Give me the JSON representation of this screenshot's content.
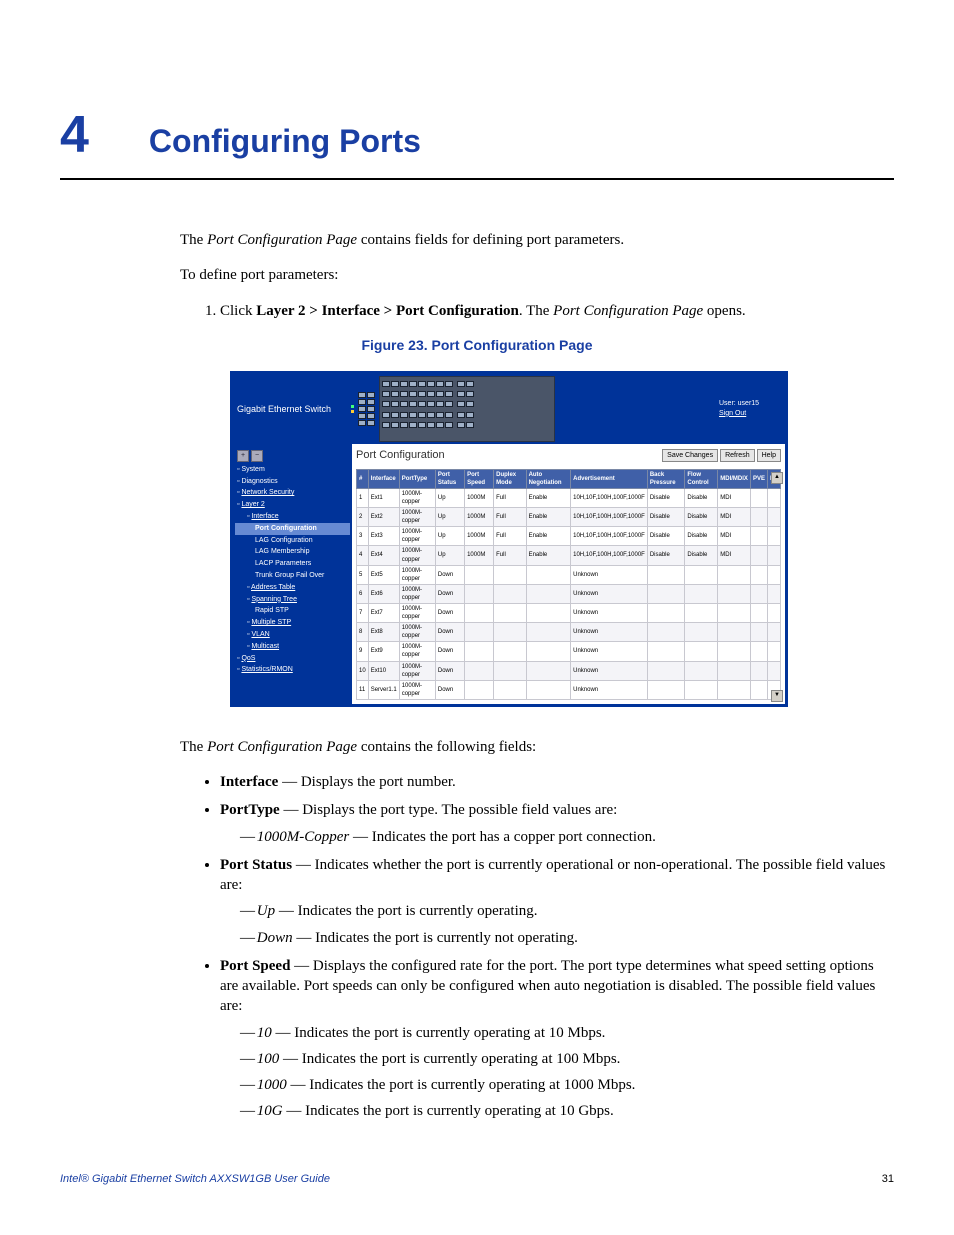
{
  "chapter": {
    "number": "4",
    "title": "Configuring Ports"
  },
  "intro_p1_a": "The ",
  "intro_p1_italic": "Port Configuration Page",
  "intro_p1_b": " contains fields for defining port parameters.",
  "intro_p2": "To define port parameters:",
  "step1_a": "Click ",
  "step1_bold": "Layer 2 > Interface > Port Configuration",
  "step1_b": ". The ",
  "step1_italic": "Port Configuration Page",
  "step1_c": " opens.",
  "figure_caption": "Figure 23. Port Configuration Page",
  "screenshot": {
    "device_name": "Gigabit Ethernet Switch",
    "user_label": "User: user15",
    "sign_out": "Sign Out",
    "page_title": "Port Configuration",
    "buttons": {
      "save": "Save Changes",
      "refresh": "Refresh",
      "help": "Help"
    },
    "nav": {
      "system": "System",
      "diagnostics": "Diagnostics",
      "netsec": "Network Security",
      "layer2": "Layer 2",
      "interface": "Interface",
      "port_config": "Port Configuration",
      "lag_config": "LAG Configuration",
      "lag_member": "LAG Membership",
      "lacp": "LACP Parameters",
      "trunk": "Trunk Group Fail Over",
      "addr_table": "Address Table",
      "spanning": "Spanning Tree",
      "rapid_stp": "Rapid STP",
      "multi_stp": "Multiple STP",
      "vlan": "VLAN",
      "multicast": "Multicast",
      "qos": "QoS",
      "stats": "Statistics/RMON"
    },
    "table": {
      "headers": [
        "#",
        "Interface",
        "PortType",
        "Port Status",
        "Port Speed",
        "Duplex Mode",
        "Auto Negotiation",
        "Advertisement",
        "Back Pressure",
        "Flow Control",
        "MDI/MDIX",
        "PVE",
        "LA"
      ],
      "rows": [
        [
          "1",
          "Ext1",
          "1000M-copper",
          "Up",
          "1000M",
          "Full",
          "Enable",
          "10H,10F,100H,100F,1000F",
          "Disable",
          "Disable",
          "MDI",
          "",
          ""
        ],
        [
          "2",
          "Ext2",
          "1000M-copper",
          "Up",
          "1000M",
          "Full",
          "Enable",
          "10H,10F,100H,100F,1000F",
          "Disable",
          "Disable",
          "MDI",
          "",
          ""
        ],
        [
          "3",
          "Ext3",
          "1000M-copper",
          "Up",
          "1000M",
          "Full",
          "Enable",
          "10H,10F,100H,100F,1000F",
          "Disable",
          "Disable",
          "MDI",
          "",
          ""
        ],
        [
          "4",
          "Ext4",
          "1000M-copper",
          "Up",
          "1000M",
          "Full",
          "Enable",
          "10H,10F,100H,100F,1000F",
          "Disable",
          "Disable",
          "MDI",
          "",
          ""
        ],
        [
          "5",
          "Ext5",
          "1000M-copper",
          "Down",
          "",
          "",
          "",
          "Unknown",
          "",
          "",
          "",
          "",
          ""
        ],
        [
          "6",
          "Ext6",
          "1000M-copper",
          "Down",
          "",
          "",
          "",
          "Unknown",
          "",
          "",
          "",
          "",
          ""
        ],
        [
          "7",
          "Ext7",
          "1000M-copper",
          "Down",
          "",
          "",
          "",
          "Unknown",
          "",
          "",
          "",
          "",
          ""
        ],
        [
          "8",
          "Ext8",
          "1000M-copper",
          "Down",
          "",
          "",
          "",
          "Unknown",
          "",
          "",
          "",
          "",
          ""
        ],
        [
          "9",
          "Ext9",
          "1000M-copper",
          "Down",
          "",
          "",
          "",
          "Unknown",
          "",
          "",
          "",
          "",
          ""
        ],
        [
          "10",
          "Ext10",
          "1000M-copper",
          "Down",
          "",
          "",
          "",
          "Unknown",
          "",
          "",
          "",
          "",
          ""
        ],
        [
          "11",
          "Server1.1",
          "1000M-copper",
          "Down",
          "",
          "",
          "",
          "Unknown",
          "",
          "",
          "",
          "",
          ""
        ]
      ]
    }
  },
  "fields_intro_a": "The ",
  "fields_intro_italic": "Port Configuration Page",
  "fields_intro_b": " contains the following fields:",
  "fields": {
    "interface": {
      "name": "Interface",
      "desc": " — Displays the port number."
    },
    "porttype": {
      "name": "PortType",
      "desc": " — Displays the port type. The possible field values are:",
      "sub1_name": "1000M-Copper",
      "sub1_desc": " — Indicates the port has a copper port connection."
    },
    "portstatus": {
      "name": "Port Status",
      "desc": " — Indicates whether the port is currently operational or non-operational. The possible field values are:",
      "sub1_name": "Up",
      "sub1_desc": " — Indicates the port is currently operating.",
      "sub2_name": "Down",
      "sub2_desc": " — Indicates the port is currently not operating."
    },
    "portspeed": {
      "name": "Port Speed",
      "desc": " — Displays the configured rate for the port. The port type determines what speed setting options are available. Port speeds can only be configured when auto negotiation is disabled. The possible field values are:",
      "sub1_name": "10",
      "sub1_desc": " — Indicates the port is currently operating at 10 Mbps.",
      "sub2_name": "100",
      "sub2_desc": " — Indicates the port is currently operating at 100 Mbps.",
      "sub3_name": "1000",
      "sub3_desc": " — Indicates the port is currently operating at 1000 Mbps.",
      "sub4_name": "10G",
      "sub4_desc": " — Indicates the port is currently operating at 10 Gbps."
    }
  },
  "footer": {
    "left": "Intel® Gigabit Ethernet Switch AXXSW1GB User Guide",
    "page": "31"
  }
}
